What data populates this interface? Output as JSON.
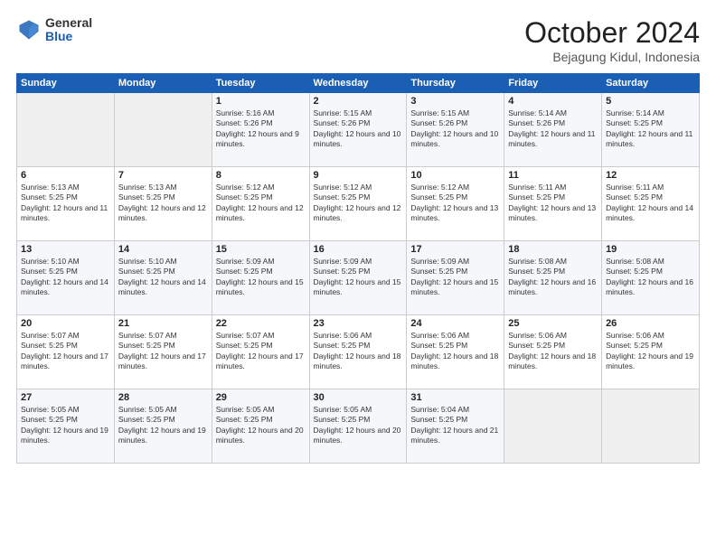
{
  "header": {
    "logo_general": "General",
    "logo_blue": "Blue",
    "month": "October 2024",
    "location": "Bejagung Kidul, Indonesia"
  },
  "calendar": {
    "days_of_week": [
      "Sunday",
      "Monday",
      "Tuesday",
      "Wednesday",
      "Thursday",
      "Friday",
      "Saturday"
    ],
    "weeks": [
      [
        {
          "day": "",
          "text": ""
        },
        {
          "day": "",
          "text": ""
        },
        {
          "day": "1",
          "text": "Sunrise: 5:16 AM\nSunset: 5:26 PM\nDaylight: 12 hours and 9 minutes."
        },
        {
          "day": "2",
          "text": "Sunrise: 5:15 AM\nSunset: 5:26 PM\nDaylight: 12 hours and 10 minutes."
        },
        {
          "day": "3",
          "text": "Sunrise: 5:15 AM\nSunset: 5:26 PM\nDaylight: 12 hours and 10 minutes."
        },
        {
          "day": "4",
          "text": "Sunrise: 5:14 AM\nSunset: 5:26 PM\nDaylight: 12 hours and 11 minutes."
        },
        {
          "day": "5",
          "text": "Sunrise: 5:14 AM\nSunset: 5:25 PM\nDaylight: 12 hours and 11 minutes."
        }
      ],
      [
        {
          "day": "6",
          "text": "Sunrise: 5:13 AM\nSunset: 5:25 PM\nDaylight: 12 hours and 11 minutes."
        },
        {
          "day": "7",
          "text": "Sunrise: 5:13 AM\nSunset: 5:25 PM\nDaylight: 12 hours and 12 minutes."
        },
        {
          "day": "8",
          "text": "Sunrise: 5:12 AM\nSunset: 5:25 PM\nDaylight: 12 hours and 12 minutes."
        },
        {
          "day": "9",
          "text": "Sunrise: 5:12 AM\nSunset: 5:25 PM\nDaylight: 12 hours and 12 minutes."
        },
        {
          "day": "10",
          "text": "Sunrise: 5:12 AM\nSunset: 5:25 PM\nDaylight: 12 hours and 13 minutes."
        },
        {
          "day": "11",
          "text": "Sunrise: 5:11 AM\nSunset: 5:25 PM\nDaylight: 12 hours and 13 minutes."
        },
        {
          "day": "12",
          "text": "Sunrise: 5:11 AM\nSunset: 5:25 PM\nDaylight: 12 hours and 14 minutes."
        }
      ],
      [
        {
          "day": "13",
          "text": "Sunrise: 5:10 AM\nSunset: 5:25 PM\nDaylight: 12 hours and 14 minutes."
        },
        {
          "day": "14",
          "text": "Sunrise: 5:10 AM\nSunset: 5:25 PM\nDaylight: 12 hours and 14 minutes."
        },
        {
          "day": "15",
          "text": "Sunrise: 5:09 AM\nSunset: 5:25 PM\nDaylight: 12 hours and 15 minutes."
        },
        {
          "day": "16",
          "text": "Sunrise: 5:09 AM\nSunset: 5:25 PM\nDaylight: 12 hours and 15 minutes."
        },
        {
          "day": "17",
          "text": "Sunrise: 5:09 AM\nSunset: 5:25 PM\nDaylight: 12 hours and 15 minutes."
        },
        {
          "day": "18",
          "text": "Sunrise: 5:08 AM\nSunset: 5:25 PM\nDaylight: 12 hours and 16 minutes."
        },
        {
          "day": "19",
          "text": "Sunrise: 5:08 AM\nSunset: 5:25 PM\nDaylight: 12 hours and 16 minutes."
        }
      ],
      [
        {
          "day": "20",
          "text": "Sunrise: 5:07 AM\nSunset: 5:25 PM\nDaylight: 12 hours and 17 minutes."
        },
        {
          "day": "21",
          "text": "Sunrise: 5:07 AM\nSunset: 5:25 PM\nDaylight: 12 hours and 17 minutes."
        },
        {
          "day": "22",
          "text": "Sunrise: 5:07 AM\nSunset: 5:25 PM\nDaylight: 12 hours and 17 minutes."
        },
        {
          "day": "23",
          "text": "Sunrise: 5:06 AM\nSunset: 5:25 PM\nDaylight: 12 hours and 18 minutes."
        },
        {
          "day": "24",
          "text": "Sunrise: 5:06 AM\nSunset: 5:25 PM\nDaylight: 12 hours and 18 minutes."
        },
        {
          "day": "25",
          "text": "Sunrise: 5:06 AM\nSunset: 5:25 PM\nDaylight: 12 hours and 18 minutes."
        },
        {
          "day": "26",
          "text": "Sunrise: 5:06 AM\nSunset: 5:25 PM\nDaylight: 12 hours and 19 minutes."
        }
      ],
      [
        {
          "day": "27",
          "text": "Sunrise: 5:05 AM\nSunset: 5:25 PM\nDaylight: 12 hours and 19 minutes."
        },
        {
          "day": "28",
          "text": "Sunrise: 5:05 AM\nSunset: 5:25 PM\nDaylight: 12 hours and 19 minutes."
        },
        {
          "day": "29",
          "text": "Sunrise: 5:05 AM\nSunset: 5:25 PM\nDaylight: 12 hours and 20 minutes."
        },
        {
          "day": "30",
          "text": "Sunrise: 5:05 AM\nSunset: 5:25 PM\nDaylight: 12 hours and 20 minutes."
        },
        {
          "day": "31",
          "text": "Sunrise: 5:04 AM\nSunset: 5:25 PM\nDaylight: 12 hours and 21 minutes."
        },
        {
          "day": "",
          "text": ""
        },
        {
          "day": "",
          "text": ""
        }
      ]
    ]
  }
}
